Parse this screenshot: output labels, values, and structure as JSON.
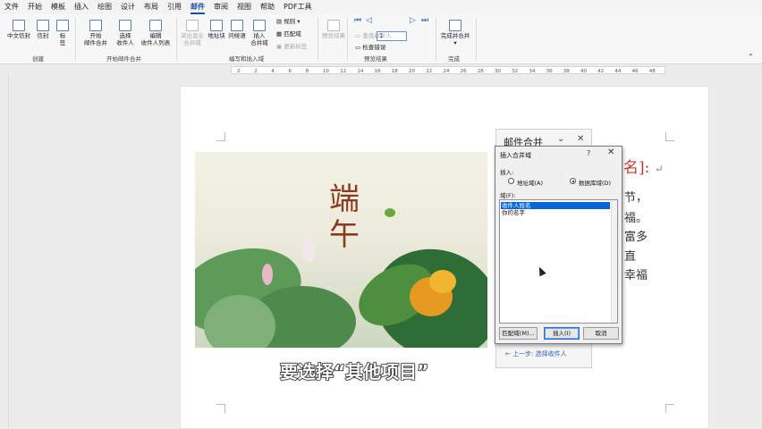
{
  "menu": {
    "items": [
      "文件",
      "开始",
      "模板",
      "插入",
      "绘图",
      "设计",
      "布局",
      "引用",
      "邮件",
      "审阅",
      "视图",
      "帮助",
      "PDF工具"
    ],
    "active_index": 8
  },
  "ribbon": {
    "create": {
      "chinese_envelope": "中文信封",
      "envelope": "信封",
      "label": "标\n签",
      "group": "创建"
    },
    "start_merge": {
      "start": "开始\n邮件合并",
      "select": "选择\n收件人",
      "edit": "编辑\n收件人列表",
      "group": "开始邮件合并"
    },
    "write_insert": {
      "highlight": "突出显示\n合并域",
      "address": "地址块",
      "greeting": "问候语",
      "insert": "插入\n合并域",
      "rules": "规则",
      "match": "匹配域",
      "update": "更新标签",
      "group": "编写和插入域"
    },
    "preview": {
      "preview": "预览结果",
      "record": "1",
      "find": "查找收件人",
      "check": "检查错误",
      "group": "预览结果"
    },
    "finish": {
      "finish": "完成并合并",
      "group": "完成"
    }
  },
  "ruler": {
    "numbers": [
      "2",
      "2",
      "4",
      "6",
      "8",
      "10",
      "12",
      "14",
      "16",
      "18",
      "20",
      "22",
      "24",
      "26",
      "28",
      "30",
      "32",
      "34",
      "36",
      "38",
      "40",
      "42",
      "44",
      "46",
      "48"
    ]
  },
  "document": {
    "greeting_tail": "名]:",
    "lines": [
      "节，",
      "福。",
      "富多",
      "直",
      "幸福"
    ],
    "image_text": "端午"
  },
  "caption": "要选择“其他项目”",
  "task_pane": {
    "title": "邮件合并",
    "back_link": "← 上一步: 选择收件人"
  },
  "dialog": {
    "title": "插入合并域",
    "help": "?",
    "insert_label": "插入:",
    "radio_address": "地址域(A)",
    "radio_database": "数据库域(D)",
    "fields_label": "域(F):",
    "fields": [
      "收件人姓名",
      "你的名字"
    ],
    "selected_index": 0,
    "match_button": "匹配域(M)...",
    "insert_button": "插入(I)",
    "cancel_button": "取消"
  }
}
